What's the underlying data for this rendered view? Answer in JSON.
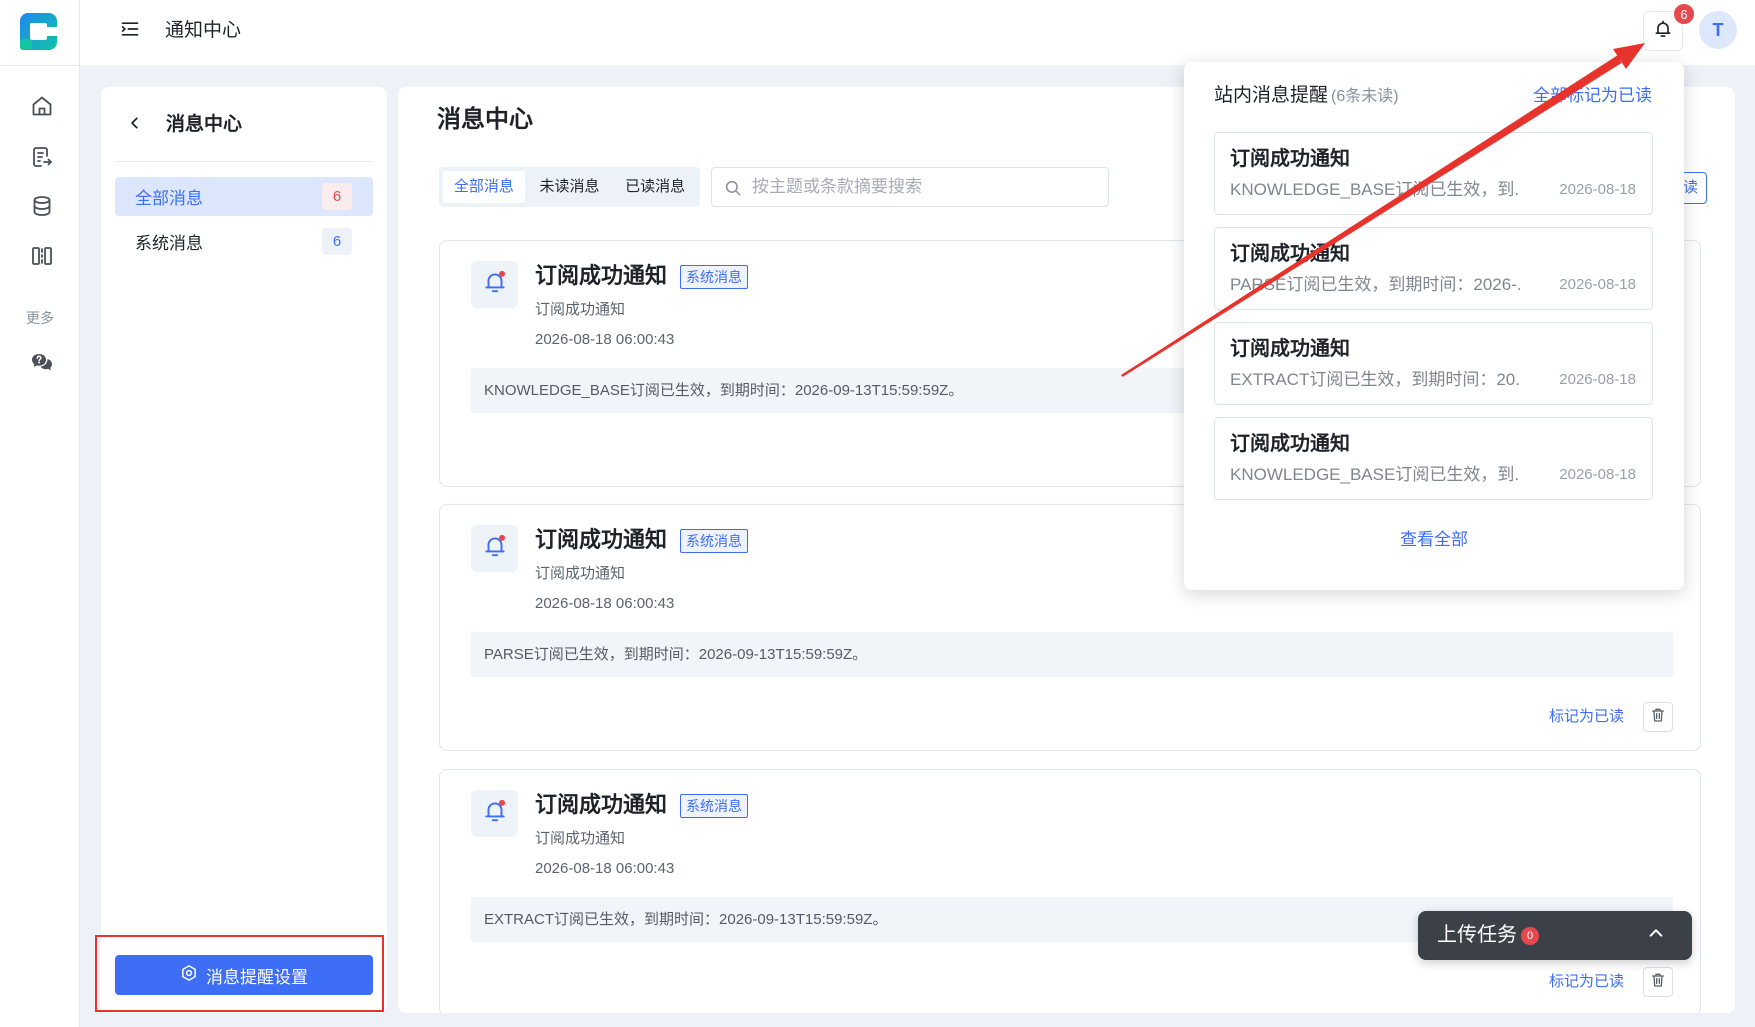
{
  "app": {
    "title": "通知中心"
  },
  "colors": {
    "accent": "#3d6ef5",
    "danger": "#e5484d",
    "annotation": "#e8332d",
    "upload_bar": "#3c4048",
    "page_bg": "#eef1f7"
  },
  "rail": {
    "items": [
      {
        "icon": "home-icon"
      },
      {
        "icon": "document-export-icon"
      },
      {
        "icon": "database-icon"
      },
      {
        "icon": "split-columns-icon"
      }
    ],
    "more_label": "更多",
    "more_items": [
      {
        "icon": "help-chat-icon"
      }
    ]
  },
  "header": {
    "title": "通知中心",
    "menu_icon": "menu-fold-icon",
    "bell_icon": "bell-icon",
    "notification_count": "6",
    "avatar_initial": "T"
  },
  "left_panel": {
    "title": "消息中心",
    "filters": [
      {
        "label": "全部消息",
        "count": "6"
      },
      {
        "label": "系统消息",
        "count": "6"
      }
    ],
    "selected_filter_index": 0,
    "settings_button": "消息提醒设置"
  },
  "main": {
    "title": "消息中心",
    "tabs": [
      {
        "label": "全部消息"
      },
      {
        "label": "未读消息"
      },
      {
        "label": "已读消息"
      }
    ],
    "active_tab_index": 0,
    "search_placeholder": "按主题或条款摘要搜索",
    "mark_all_label": "读",
    "messages": [
      {
        "title": "订阅成功通知",
        "tag": "系统消息",
        "subtitle": "订阅成功通知",
        "time": "2026-08-18 06:00:43",
        "content": "KNOWLEDGE_BASE订阅已生效，到期时间：2026-09-13T15:59:59Z。"
      },
      {
        "title": "订阅成功通知",
        "tag": "系统消息",
        "subtitle": "订阅成功通知",
        "time": "2026-08-18 06:00:43",
        "content": "PARSE订阅已生效，到期时间：2026-09-13T15:59:59Z。",
        "action": "标记为已读"
      },
      {
        "title": "订阅成功通知",
        "tag": "系统消息",
        "subtitle": "订阅成功通知",
        "time": "2026-08-18 06:00:43",
        "content": "EXTRACT订阅已生效，到期时间：2026-09-13T15:59:59Z。",
        "action": "标记为已读"
      }
    ]
  },
  "popover": {
    "title": "站内消息提醒",
    "unread_summary": "(6条未读)",
    "mark_all": "全部标记为已读",
    "items": [
      {
        "title": "订阅成功通知",
        "excerpt": "KNOWLEDGE_BASE订阅已生效，到...",
        "date": "2026-08-18"
      },
      {
        "title": "订阅成功通知",
        "excerpt": "PARSE订阅已生效，到期时间：2026-...",
        "date": "2026-08-18"
      },
      {
        "title": "订阅成功通知",
        "excerpt": "EXTRACT订阅已生效，到期时间：20...",
        "date": "2026-08-18"
      },
      {
        "title": "订阅成功通知",
        "excerpt": "KNOWLEDGE_BASE订阅已生效，到...",
        "date": "2026-08-18"
      }
    ],
    "view_all": "查看全部"
  },
  "upload_task": {
    "label": "上传任务",
    "count": "0"
  }
}
